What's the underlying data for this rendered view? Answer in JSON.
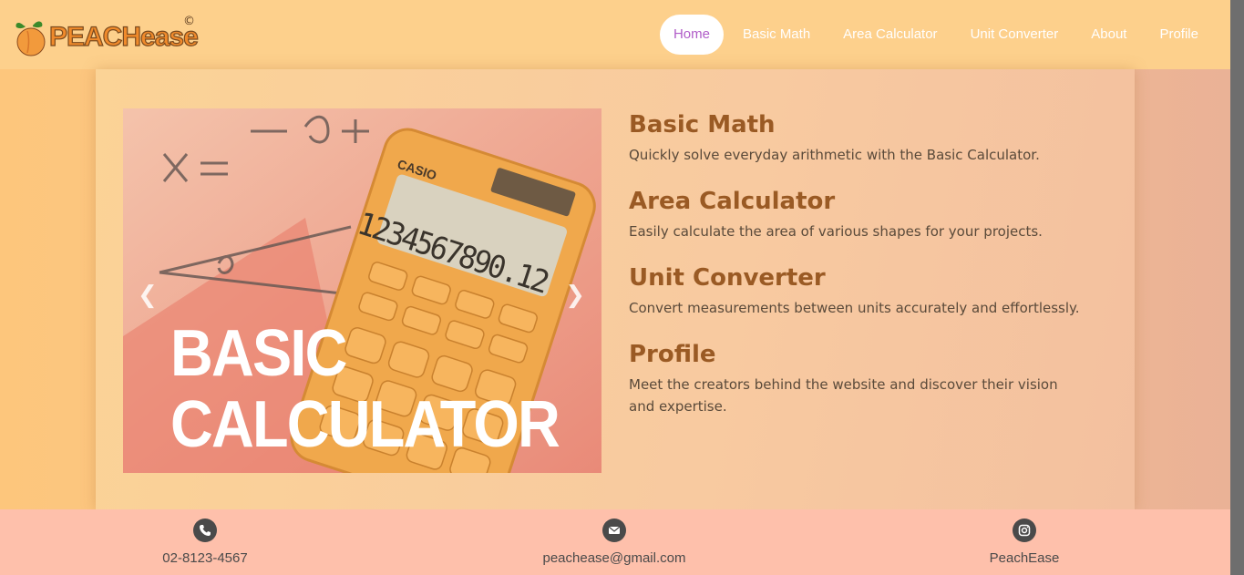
{
  "brand": {
    "name": "PEACHease",
    "mark": "©"
  },
  "nav": [
    {
      "label": "Home",
      "active": true
    },
    {
      "label": "Basic Math"
    },
    {
      "label": "Area Calculator"
    },
    {
      "label": "Unit Converter"
    },
    {
      "label": "About"
    },
    {
      "label": "Profile"
    }
  ],
  "carousel": {
    "slide_title_line1": "BASIC",
    "slide_title_line2": "CALCULATOR",
    "calculator_brand": "CASIO",
    "calculator_display": "1234567890.12",
    "prev_icon": "chevron-left-icon",
    "next_icon": "chevron-right-icon"
  },
  "features": [
    {
      "title": "Basic Math",
      "desc": "Quickly solve everyday arithmetic with the Basic Calculator."
    },
    {
      "title": "Area Calculator",
      "desc": "Easily calculate the area of various shapes for your projects."
    },
    {
      "title": "Unit Converter",
      "desc": "Convert measurements between units accurately and effortlessly."
    },
    {
      "title": "Profile",
      "desc": "Meet the creators behind the website and discover their vision and expertise."
    }
  ],
  "footer": {
    "phone": "02-8123-4567",
    "email": "peachease@gmail.com",
    "instagram": "PeachEase"
  },
  "colors": {
    "header_bg": "#fdd08c",
    "footer_bg": "#fec0ab",
    "accent": "#9a5a24",
    "active_nav": "#b05cc8"
  }
}
